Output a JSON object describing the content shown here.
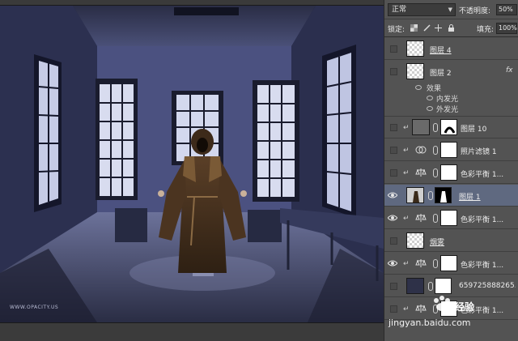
{
  "panel": {
    "blend_mode": "正常",
    "opacity_label": "不透明度:",
    "opacity_value": "50%",
    "lock_label": "锁定:",
    "fill_label": "填充:",
    "fill_value": "100%"
  },
  "layers": [
    {
      "name": "图层 4",
      "visible": false,
      "kind": "pixel"
    },
    {
      "name": "图层 2",
      "visible": false,
      "kind": "pixel",
      "fx": "fx"
    },
    {
      "name": "图层 10",
      "visible": false,
      "kind": "masked"
    },
    {
      "name": "照片滤镜 1",
      "visible": false,
      "kind": "adjustment"
    },
    {
      "name": "色彩平衡 1...",
      "visible": false,
      "kind": "adjustment"
    },
    {
      "name": "图层 1",
      "visible": true,
      "kind": "masked",
      "selected": true
    },
    {
      "name": "色彩平衡 1...",
      "visible": true,
      "kind": "adjustment"
    },
    {
      "name": "烟雾",
      "visible": false,
      "kind": "pixel"
    },
    {
      "name": "色彩平衡 1...",
      "visible": true,
      "kind": "adjustment"
    },
    {
      "name": "659725888265...",
      "visible": false,
      "kind": "masked"
    },
    {
      "name": "色彩平衡 1...",
      "visible": false,
      "kind": "adjustment"
    }
  ],
  "effects": {
    "header": "效果",
    "items": [
      "内发光",
      "外发光"
    ]
  },
  "canvas": {
    "credit": "WWW.OPACITY.US"
  },
  "watermark": {
    "brand": "经验",
    "url": "jingyan.baidu.com"
  },
  "icons": {
    "eye": "eye-icon",
    "link": "link-icon",
    "adjustment": "balance-icon",
    "photo_filter": "photo-filter-icon",
    "lock": "lock-icon"
  }
}
